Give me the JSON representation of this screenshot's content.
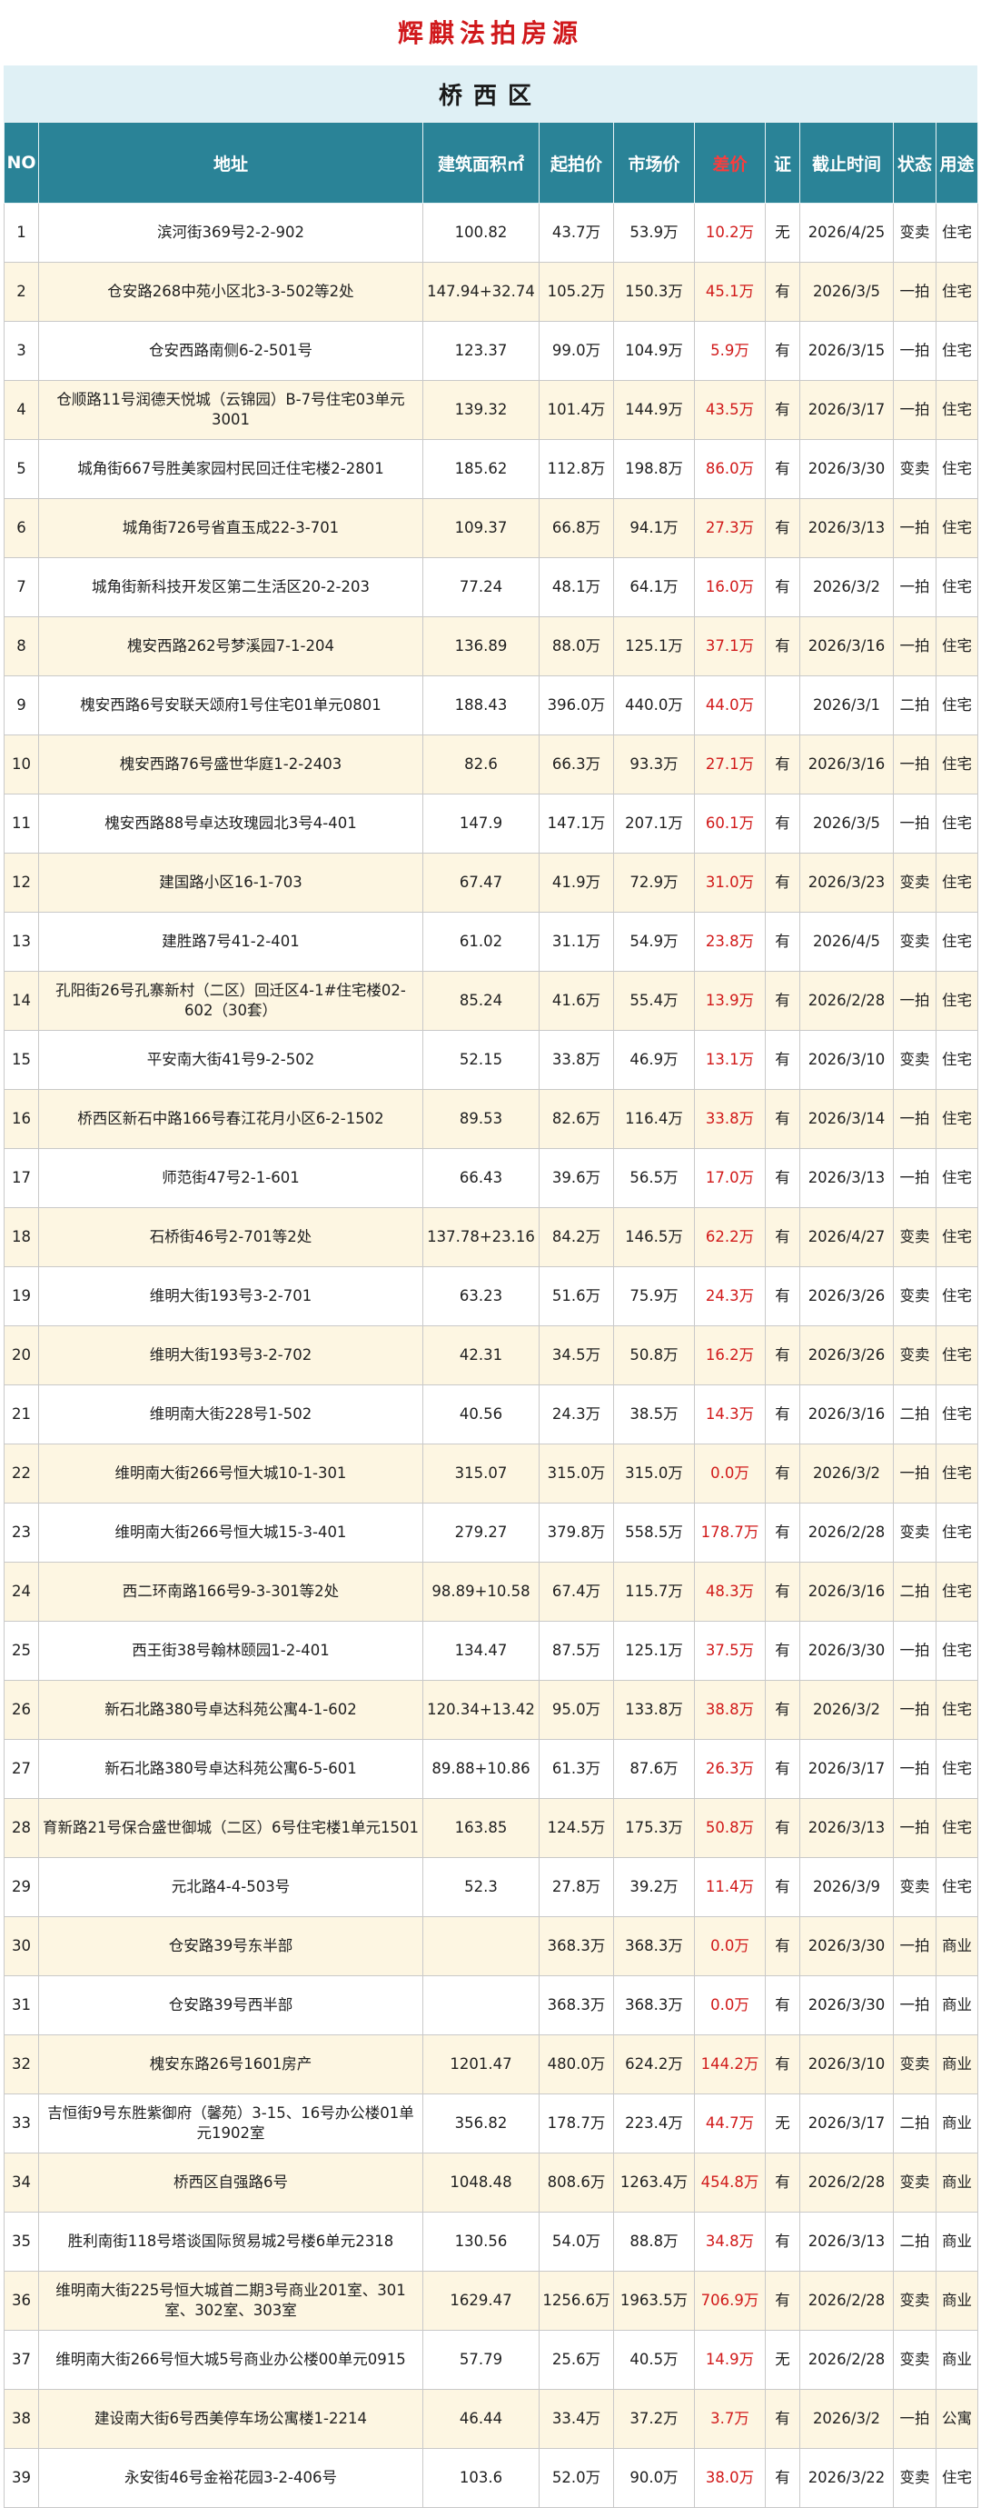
{
  "page_title": "辉麒法拍房源",
  "district": "桥西区",
  "columns": [
    "NO",
    "地址",
    "建筑面积㎡",
    "起拍价",
    "市场价",
    "差价",
    "证",
    "截止时间",
    "状态",
    "用途"
  ],
  "rows": [
    {
      "no": "1",
      "addr": "滨河街369号2-2-902",
      "area": "100.82",
      "start": "43.7万",
      "market": "53.9万",
      "diff": "10.2万",
      "cert": "无",
      "deadline": "2026/4/25",
      "status": "变卖",
      "use": "住宅"
    },
    {
      "no": "2",
      "addr": "仓安路268中苑小区北3-3-502等2处",
      "area": "147.94+32.74",
      "start": "105.2万",
      "market": "150.3万",
      "diff": "45.1万",
      "cert": "有",
      "deadline": "2026/3/5",
      "status": "一拍",
      "use": "住宅"
    },
    {
      "no": "3",
      "addr": "仓安西路南侧6-2-501号",
      "area": "123.37",
      "start": "99.0万",
      "market": "104.9万",
      "diff": "5.9万",
      "cert": "有",
      "deadline": "2026/3/15",
      "status": "一拍",
      "use": "住宅"
    },
    {
      "no": "4",
      "addr": "仓顺路11号润德天悦城（云锦园）B-7号住宅03单元3001",
      "area": "139.32",
      "start": "101.4万",
      "market": "144.9万",
      "diff": "43.5万",
      "cert": "有",
      "deadline": "2026/3/17",
      "status": "一拍",
      "use": "住宅"
    },
    {
      "no": "5",
      "addr": "城角街667号胜美家园村民回迁住宅楼2-2801",
      "area": "185.62",
      "start": "112.8万",
      "market": "198.8万",
      "diff": "86.0万",
      "cert": "有",
      "deadline": "2026/3/30",
      "status": "变卖",
      "use": "住宅"
    },
    {
      "no": "6",
      "addr": "城角街726号省直玉成22-3-701",
      "area": "109.37",
      "start": "66.8万",
      "market": "94.1万",
      "diff": "27.3万",
      "cert": "有",
      "deadline": "2026/3/13",
      "status": "一拍",
      "use": "住宅"
    },
    {
      "no": "7",
      "addr": "城角街新科技开发区第二生活区20-2-203",
      "area": "77.24",
      "start": "48.1万",
      "market": "64.1万",
      "diff": "16.0万",
      "cert": "有",
      "deadline": "2026/3/2",
      "status": "一拍",
      "use": "住宅"
    },
    {
      "no": "8",
      "addr": "槐安西路262号梦溪园7-1-204",
      "area": "136.89",
      "start": "88.0万",
      "market": "125.1万",
      "diff": "37.1万",
      "cert": "有",
      "deadline": "2026/3/16",
      "status": "一拍",
      "use": "住宅"
    },
    {
      "no": "9",
      "addr": "槐安西路6号安联天颂府1号住宅01单元0801",
      "area": "188.43",
      "start": "396.0万",
      "market": "440.0万",
      "diff": "44.0万",
      "cert": "",
      "deadline": "2026/3/1",
      "status": "二拍",
      "use": "住宅"
    },
    {
      "no": "10",
      "addr": "槐安西路76号盛世华庭1-2-2403",
      "area": "82.6",
      "start": "66.3万",
      "market": "93.3万",
      "diff": "27.1万",
      "cert": "有",
      "deadline": "2026/3/16",
      "status": "一拍",
      "use": "住宅"
    },
    {
      "no": "11",
      "addr": "槐安西路88号卓达玫瑰园北3号4-401",
      "area": "147.9",
      "start": "147.1万",
      "market": "207.1万",
      "diff": "60.1万",
      "cert": "有",
      "deadline": "2026/3/5",
      "status": "一拍",
      "use": "住宅"
    },
    {
      "no": "12",
      "addr": "建国路小区16-1-703",
      "area": "67.47",
      "start": "41.9万",
      "market": "72.9万",
      "diff": "31.0万",
      "cert": "有",
      "deadline": "2026/3/23",
      "status": "变卖",
      "use": "住宅"
    },
    {
      "no": "13",
      "addr": "建胜路7号41-2-401",
      "area": "61.02",
      "start": "31.1万",
      "market": "54.9万",
      "diff": "23.8万",
      "cert": "有",
      "deadline": "2026/4/5",
      "status": "变卖",
      "use": "住宅"
    },
    {
      "no": "14",
      "addr": "孔阳街26号孔寨新村（二区）回迁区4-1#住宅楼02-602（30套）",
      "area": "85.24",
      "start": "41.6万",
      "market": "55.4万",
      "diff": "13.9万",
      "cert": "有",
      "deadline": "2026/2/28",
      "status": "一拍",
      "use": "住宅"
    },
    {
      "no": "15",
      "addr": "平安南大街41号9-2-502",
      "area": "52.15",
      "start": "33.8万",
      "market": "46.9万",
      "diff": "13.1万",
      "cert": "有",
      "deadline": "2026/3/10",
      "status": "变卖",
      "use": "住宅"
    },
    {
      "no": "16",
      "addr": "桥西区新石中路166号春江花月小区6-2-1502",
      "area": "89.53",
      "start": "82.6万",
      "market": "116.4万",
      "diff": "33.8万",
      "cert": "有",
      "deadline": "2026/3/14",
      "status": "一拍",
      "use": "住宅"
    },
    {
      "no": "17",
      "addr": "师范街47号2-1-601",
      "area": "66.43",
      "start": "39.6万",
      "market": "56.5万",
      "diff": "17.0万",
      "cert": "有",
      "deadline": "2026/3/13",
      "status": "一拍",
      "use": "住宅"
    },
    {
      "no": "18",
      "addr": "石桥街46号2-701等2处",
      "area": "137.78+23.16",
      "start": "84.2万",
      "market": "146.5万",
      "diff": "62.2万",
      "cert": "有",
      "deadline": "2026/4/27",
      "status": "变卖",
      "use": "住宅"
    },
    {
      "no": "19",
      "addr": "维明大街193号3-2-701",
      "area": "63.23",
      "start": "51.6万",
      "market": "75.9万",
      "diff": "24.3万",
      "cert": "有",
      "deadline": "2026/3/26",
      "status": "变卖",
      "use": "住宅"
    },
    {
      "no": "20",
      "addr": "维明大街193号3-2-702",
      "area": "42.31",
      "start": "34.5万",
      "market": "50.8万",
      "diff": "16.2万",
      "cert": "有",
      "deadline": "2026/3/26",
      "status": "变卖",
      "use": "住宅"
    },
    {
      "no": "21",
      "addr": "维明南大街228号1-502",
      "area": "40.56",
      "start": "24.3万",
      "market": "38.5万",
      "diff": "14.3万",
      "cert": "有",
      "deadline": "2026/3/16",
      "status": "二拍",
      "use": "住宅"
    },
    {
      "no": "22",
      "addr": "维明南大街266号恒大城10-1-301",
      "area": "315.07",
      "start": "315.0万",
      "market": "315.0万",
      "diff": "0.0万",
      "cert": "有",
      "deadline": "2026/3/2",
      "status": "一拍",
      "use": "住宅"
    },
    {
      "no": "23",
      "addr": "维明南大街266号恒大城15-3-401",
      "area": "279.27",
      "start": "379.8万",
      "market": "558.5万",
      "diff": "178.7万",
      "cert": "有",
      "deadline": "2026/2/28",
      "status": "变卖",
      "use": "住宅"
    },
    {
      "no": "24",
      "addr": "西二环南路166号9-3-301等2处",
      "area": "98.89+10.58",
      "start": "67.4万",
      "market": "115.7万",
      "diff": "48.3万",
      "cert": "有",
      "deadline": "2026/3/16",
      "status": "二拍",
      "use": "住宅"
    },
    {
      "no": "25",
      "addr": "西王街38号翰林颐园1-2-401",
      "area": "134.47",
      "start": "87.5万",
      "market": "125.1万",
      "diff": "37.5万",
      "cert": "有",
      "deadline": "2026/3/30",
      "status": "一拍",
      "use": "住宅"
    },
    {
      "no": "26",
      "addr": "新石北路380号卓达科苑公寓4-1-602",
      "area": "120.34+13.42",
      "start": "95.0万",
      "market": "133.8万",
      "diff": "38.8万",
      "cert": "有",
      "deadline": "2026/3/2",
      "status": "一拍",
      "use": "住宅"
    },
    {
      "no": "27",
      "addr": "新石北路380号卓达科苑公寓6-5-601",
      "area": "89.88+10.86",
      "start": "61.3万",
      "market": "87.6万",
      "diff": "26.3万",
      "cert": "有",
      "deadline": "2026/3/17",
      "status": "一拍",
      "use": "住宅"
    },
    {
      "no": "28",
      "addr": "育新路21号保合盛世御城（二区）6号住宅楼1单元1501",
      "area": "163.85",
      "start": "124.5万",
      "market": "175.3万",
      "diff": "50.8万",
      "cert": "有",
      "deadline": "2026/3/13",
      "status": "一拍",
      "use": "住宅"
    },
    {
      "no": "29",
      "addr": "元北路4-4-503号",
      "area": "52.3",
      "start": "27.8万",
      "market": "39.2万",
      "diff": "11.4万",
      "cert": "有",
      "deadline": "2026/3/9",
      "status": "变卖",
      "use": "住宅"
    },
    {
      "no": "30",
      "addr": "仓安路39号东半部",
      "area": "",
      "start": "368.3万",
      "market": "368.3万",
      "diff": "0.0万",
      "cert": "有",
      "deadline": "2026/3/30",
      "status": "一拍",
      "use": "商业"
    },
    {
      "no": "31",
      "addr": "仓安路39号西半部",
      "area": "",
      "start": "368.3万",
      "market": "368.3万",
      "diff": "0.0万",
      "cert": "有",
      "deadline": "2026/3/30",
      "status": "一拍",
      "use": "商业"
    },
    {
      "no": "32",
      "addr": "槐安东路26号1601房产",
      "area": "1201.47",
      "start": "480.0万",
      "market": "624.2万",
      "diff": "144.2万",
      "cert": "有",
      "deadline": "2026/3/10",
      "status": "变卖",
      "use": "商业"
    },
    {
      "no": "33",
      "addr": "吉恒街9号东胜紫御府（馨苑）3-15、16号办公楼01单元1902室",
      "area": "356.82",
      "start": "178.7万",
      "market": "223.4万",
      "diff": "44.7万",
      "cert": "无",
      "deadline": "2026/3/17",
      "status": "二拍",
      "use": "商业"
    },
    {
      "no": "34",
      "addr": "桥西区自强路6号",
      "area": "1048.48",
      "start": "808.6万",
      "market": "1263.4万",
      "diff": "454.8万",
      "cert": "有",
      "deadline": "2026/2/28",
      "status": "变卖",
      "use": "商业"
    },
    {
      "no": "35",
      "addr": "胜利南街118号塔谈国际贸易城2号楼6单元2318",
      "area": "130.56",
      "start": "54.0万",
      "market": "88.8万",
      "diff": "34.8万",
      "cert": "有",
      "deadline": "2026/3/13",
      "status": "二拍",
      "use": "商业"
    },
    {
      "no": "36",
      "addr": "维明南大街225号恒大城首二期3号商业201室、301室、302室、303室",
      "area": "1629.47",
      "start": "1256.6万",
      "market": "1963.5万",
      "diff": "706.9万",
      "cert": "有",
      "deadline": "2026/2/28",
      "status": "变卖",
      "use": "商业"
    },
    {
      "no": "37",
      "addr": "维明南大街266号恒大城5号商业办公楼00单元0915",
      "area": "57.79",
      "start": "25.6万",
      "market": "40.5万",
      "diff": "14.9万",
      "cert": "无",
      "deadline": "2026/2/28",
      "status": "变卖",
      "use": "商业"
    },
    {
      "no": "38",
      "addr": "建设南大街6号西美停车场公寓楼1-2214",
      "area": "46.44",
      "start": "33.4万",
      "market": "37.2万",
      "diff": "3.7万",
      "cert": "有",
      "deadline": "2026/3/2",
      "status": "一拍",
      "use": "公寓"
    },
    {
      "no": "39",
      "addr": "永安街46号金裕花园3-2-406号",
      "area": "103.6",
      "start": "52.0万",
      "market": "90.0万",
      "diff": "38.0万",
      "cert": "有",
      "deadline": "2026/3/22",
      "status": "变卖",
      "use": "住宅"
    }
  ]
}
